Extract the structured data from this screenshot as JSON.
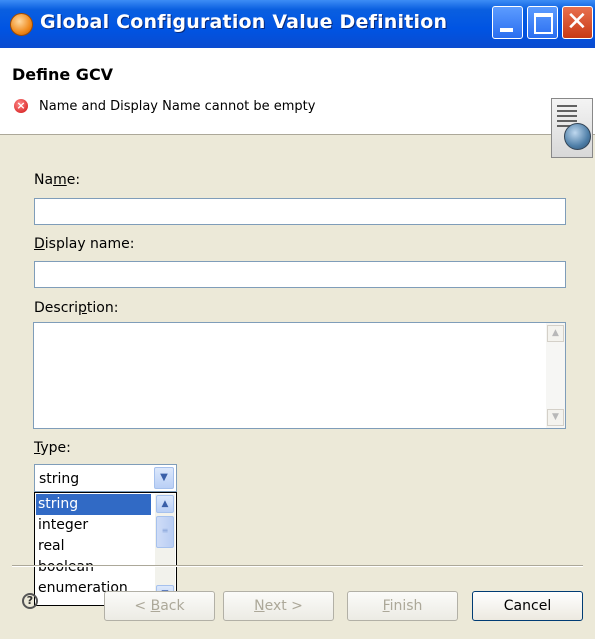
{
  "window": {
    "title": "Global Configuration Value Definition"
  },
  "header": {
    "title": "Define GCV",
    "error_message": "Name and Display Name cannot be empty"
  },
  "form": {
    "name_label_pre": "Na",
    "name_label_key": "m",
    "name_label_post": "e:",
    "name_value": "",
    "display_label_key": "D",
    "display_label_post": "isplay name:",
    "display_value": "",
    "description_label_pre": "Descri",
    "description_label_key": "p",
    "description_label_post": "tion:",
    "description_value": "",
    "type_label_key": "T",
    "type_label_post": "ype:",
    "type_selected": "string",
    "type_options": [
      "string",
      "integer",
      "real",
      "boolean",
      "enumeration"
    ]
  },
  "footer": {
    "back_pre": "< ",
    "back_key": "B",
    "back_post": "ack",
    "next_key": "N",
    "next_post": "ext >",
    "finish_key": "F",
    "finish_post": "inish",
    "cancel": "Cancel"
  },
  "colors": {
    "title_bar": "#0054e3",
    "selection": "#316ac5",
    "dialog_bg": "#ece9d8",
    "error": "#d01010"
  },
  "icons": [
    "app-icon",
    "minimize-icon",
    "maximize-icon",
    "close-icon",
    "error-icon",
    "banner-icon",
    "help-icon",
    "scroll-up-icon",
    "scroll-down-icon",
    "combo-arrow-icon"
  ]
}
